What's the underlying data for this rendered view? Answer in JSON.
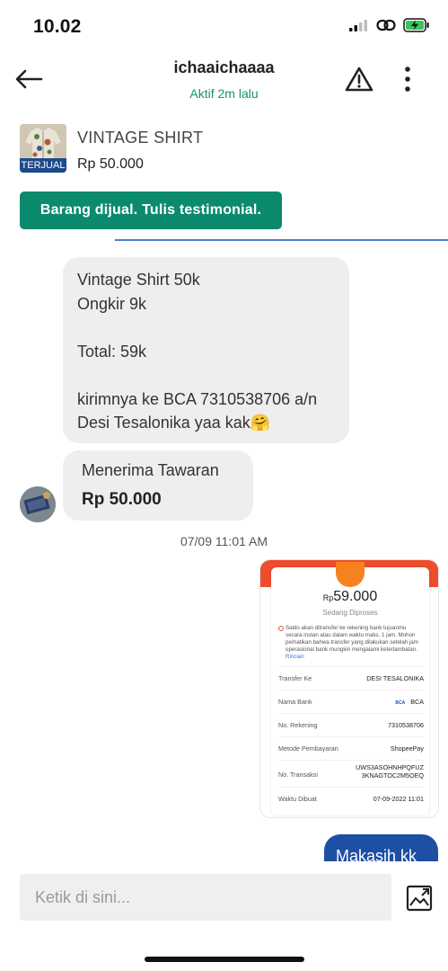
{
  "status_bar": {
    "time": "10.02",
    "icons": [
      "signal-icon",
      "link-icon",
      "battery-charging-icon"
    ],
    "battery_color": "#34c759"
  },
  "header": {
    "name": "ichaaichaaaa",
    "status": "Aktif 2m lalu",
    "back_icon": "back-arrow-icon",
    "report_icon": "warning-icon",
    "more_icon": "more-vertical-icon"
  },
  "product": {
    "badge": "TERJUAL",
    "name": "VINTAGE SHIRT",
    "price": "Rp 50.000"
  },
  "cta": {
    "label": "Barang dijual. Tulis testimonial.",
    "color": "#0c8a6e"
  },
  "messages": {
    "invoice_text": "Vintage Shirt 50k\nOngkir 9k\n\nTotal: 59k\n\nkirimnya ke BCA 7310538706 a/n\nDesi Tesalonika yaa kak🤗",
    "offer_label": "Menerima Tawaran",
    "offer_price": "Rp 50.000",
    "timestamp": "07/09 11:01 AM",
    "reply": "Makasih kk"
  },
  "receipt": {
    "currency": "Rp",
    "amount": "59.000",
    "state": "Sedang Diproses",
    "note": "Saldo akan ditransfer ke rekening bank tujuanmu secara instan atau dalam waktu maks. 1 jam. Mohon perhatikan bahwa transfer yang dilakukan setelah jam operasional bank mungkin mengalami keterlambatan.",
    "note_link": "Rincian",
    "rows": [
      {
        "key": "Transfer Ke",
        "value": "DESI TESALONIKA"
      },
      {
        "key": "Nama Bank",
        "value": "BCA",
        "logo": "BCA"
      },
      {
        "key": "No. Rekening",
        "value": "7310538706"
      },
      {
        "key": "Metode Pembayaran",
        "value": "ShopeePay"
      },
      {
        "key": "No. Transaksi",
        "value": "UWS3ASOHNHPQFUZ\n3KNAGTOC2M5OEQ"
      },
      {
        "key": "Waktu Dibuat",
        "value": "07-09-2022 11:01"
      }
    ],
    "accent": "#ee4d2d"
  },
  "composer": {
    "placeholder": "Ketik di sini...",
    "image_icon": "image-upload-icon"
  },
  "colors": {
    "accent_green": "#1a8f6f",
    "outgoing_bubble": "#1d4fa3",
    "incoming_bubble": "#eeeeee"
  }
}
